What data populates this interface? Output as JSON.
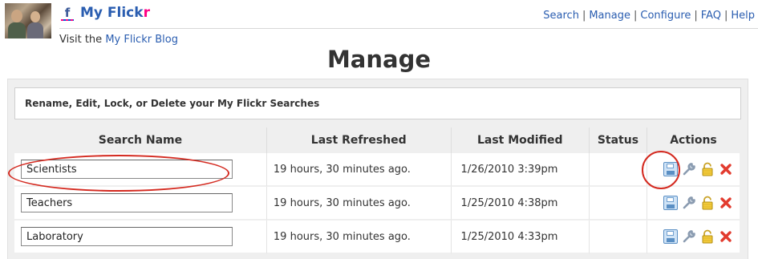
{
  "header": {
    "app_icon": "facebook-f-icon",
    "app_title_main": "My Flick",
    "app_title_accent": "r",
    "blog_prefix": "Visit the ",
    "blog_link": "My Flickr Blog"
  },
  "nav": [
    {
      "label": "Search"
    },
    {
      "label": "Manage"
    },
    {
      "label": "Configure"
    },
    {
      "label": "FAQ"
    },
    {
      "label": "Help"
    }
  ],
  "page": {
    "title": "Manage",
    "description": "Rename, Edit, Lock, or Delete your My Flickr Searches"
  },
  "table": {
    "headers": [
      "Search Name",
      "Last Refreshed",
      "Last Modified",
      "Status",
      "Actions"
    ],
    "rows": [
      {
        "name": "Scientists",
        "refreshed": "19 hours, 30 minutes ago.",
        "modified": "1/26/2010 3:39pm",
        "status": ""
      },
      {
        "name": "Teachers",
        "refreshed": "19 hours, 30 minutes ago.",
        "modified": "1/25/2010 4:38pm",
        "status": ""
      },
      {
        "name": "Laboratory",
        "refreshed": "19 hours, 30 minutes ago.",
        "modified": "1/25/2010 4:33pm",
        "status": ""
      }
    ],
    "action_icons": [
      "save-icon",
      "wrench-icon",
      "lock-icon",
      "delete-icon"
    ]
  },
  "colors": {
    "link": "#2a5db0",
    "flickr_pink": "#ff0084",
    "annotation": "#d42a20",
    "delete": "#e23b2e"
  }
}
